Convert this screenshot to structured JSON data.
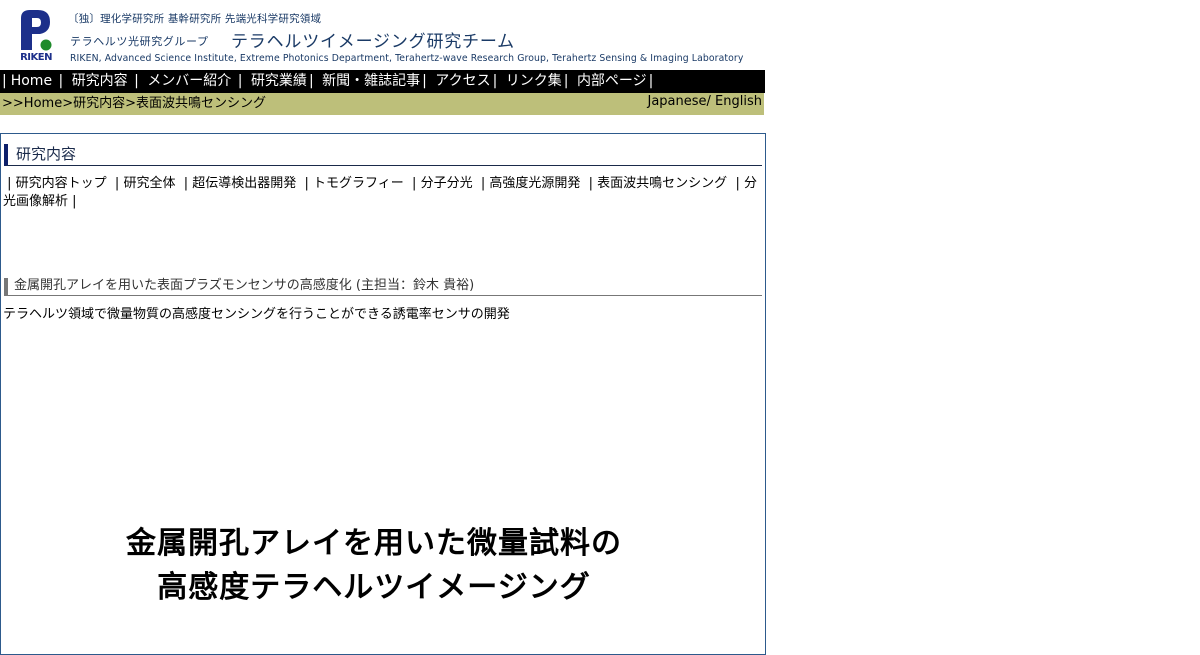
{
  "header": {
    "logo_text": "RIKEN",
    "line1": "〔独〕理化学研究所 基幹研究所 先端光科学研究領域",
    "group_name": "テラヘルツ光研究グループ",
    "team_name": "テラヘルツイメージング研究チーム",
    "english_line": "RIKEN, Advanced Science Institute, Extreme Photonics Department, Terahertz-wave Research Group, Terahertz Sensing & Imaging Laboratory"
  },
  "nav": {
    "items": [
      "Home",
      "研究内容",
      "メンバー紹介",
      "研究業績",
      "新聞・雑誌記事",
      "アクセス",
      "リンク集",
      "内部ページ"
    ]
  },
  "breadcrumb": {
    "prefix": ">>",
    "home": "Home",
    "research": "研究内容",
    "current": "表面波共鳴センシング"
  },
  "lang": {
    "japanese": "Japanese",
    "english": "English"
  },
  "section": {
    "title": "研究内容",
    "subnav": [
      "研究内容トップ",
      "研究全体",
      "超伝導検出器開発",
      "トモグラフィー",
      "分子分光",
      "高強度光源開発",
      "表面波共鳴センシング",
      "分光画像解析"
    ]
  },
  "topic": {
    "title": "金属開孔アレイを用いた表面プラズモンセンサの高感度化 (主担当：鈴木 貴裕)",
    "description": "テラヘルツ領域で微量物質の高感度センシングを行うことができる誘電率センサの開発"
  },
  "poster": {
    "line1": "金属開孔アレイを用いた微量試料の",
    "line2": "高感度テラヘルツイメージング"
  },
  "colors": {
    "nav_bg": "#000000",
    "crumb_bg": "#bdbf7a",
    "logo_blue": "#1c2f8a",
    "logo_green": "#1e8a2a"
  }
}
